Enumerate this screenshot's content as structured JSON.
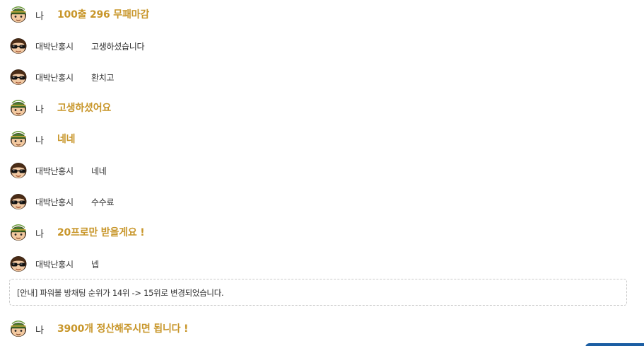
{
  "messages": [
    {
      "sender": "나",
      "text": "100출 296 무패마감",
      "is_me": true,
      "avatar_icon": "user-avatar-green-hat-icon"
    },
    {
      "sender": "대박난홍시",
      "text": "고생하셨습니다",
      "is_me": false,
      "avatar_icon": "user-avatar-sunglasses-icon"
    },
    {
      "sender": "대박난홍시",
      "text": "환치고",
      "is_me": false,
      "avatar_icon": "user-avatar-sunglasses-icon"
    },
    {
      "sender": "나",
      "text": "고생하셨어요",
      "is_me": true,
      "avatar_icon": "user-avatar-green-hat-icon"
    },
    {
      "sender": "나",
      "text": "네네",
      "is_me": true,
      "avatar_icon": "user-avatar-green-hat-icon"
    },
    {
      "sender": "대박난홍시",
      "text": "네네",
      "is_me": false,
      "avatar_icon": "user-avatar-sunglasses-icon"
    },
    {
      "sender": "대박난홍시",
      "text": "수수료",
      "is_me": false,
      "avatar_icon": "user-avatar-sunglasses-icon"
    },
    {
      "sender": "나",
      "text": "20프로만 받을게요 !",
      "is_me": true,
      "avatar_icon": "user-avatar-green-hat-icon"
    },
    {
      "sender": "대박난홍시",
      "text": "넵",
      "is_me": false,
      "avatar_icon": "user-avatar-sunglasses-icon"
    }
  ],
  "notice": {
    "text": "[안내] 파워볼 방채팅 순위가 14위 -> 15위로 변경되었습니다."
  },
  "last_message": {
    "sender": "나",
    "text": "3900개 정산해주시면 됩니다 !",
    "is_me": true,
    "avatar_icon": "user-avatar-green-hat-icon"
  },
  "colors": {
    "my_message": "#c8962a",
    "other_message": "#333333",
    "notice_border": "#c9c9c9",
    "corner_tab": "#1b5ea3"
  }
}
